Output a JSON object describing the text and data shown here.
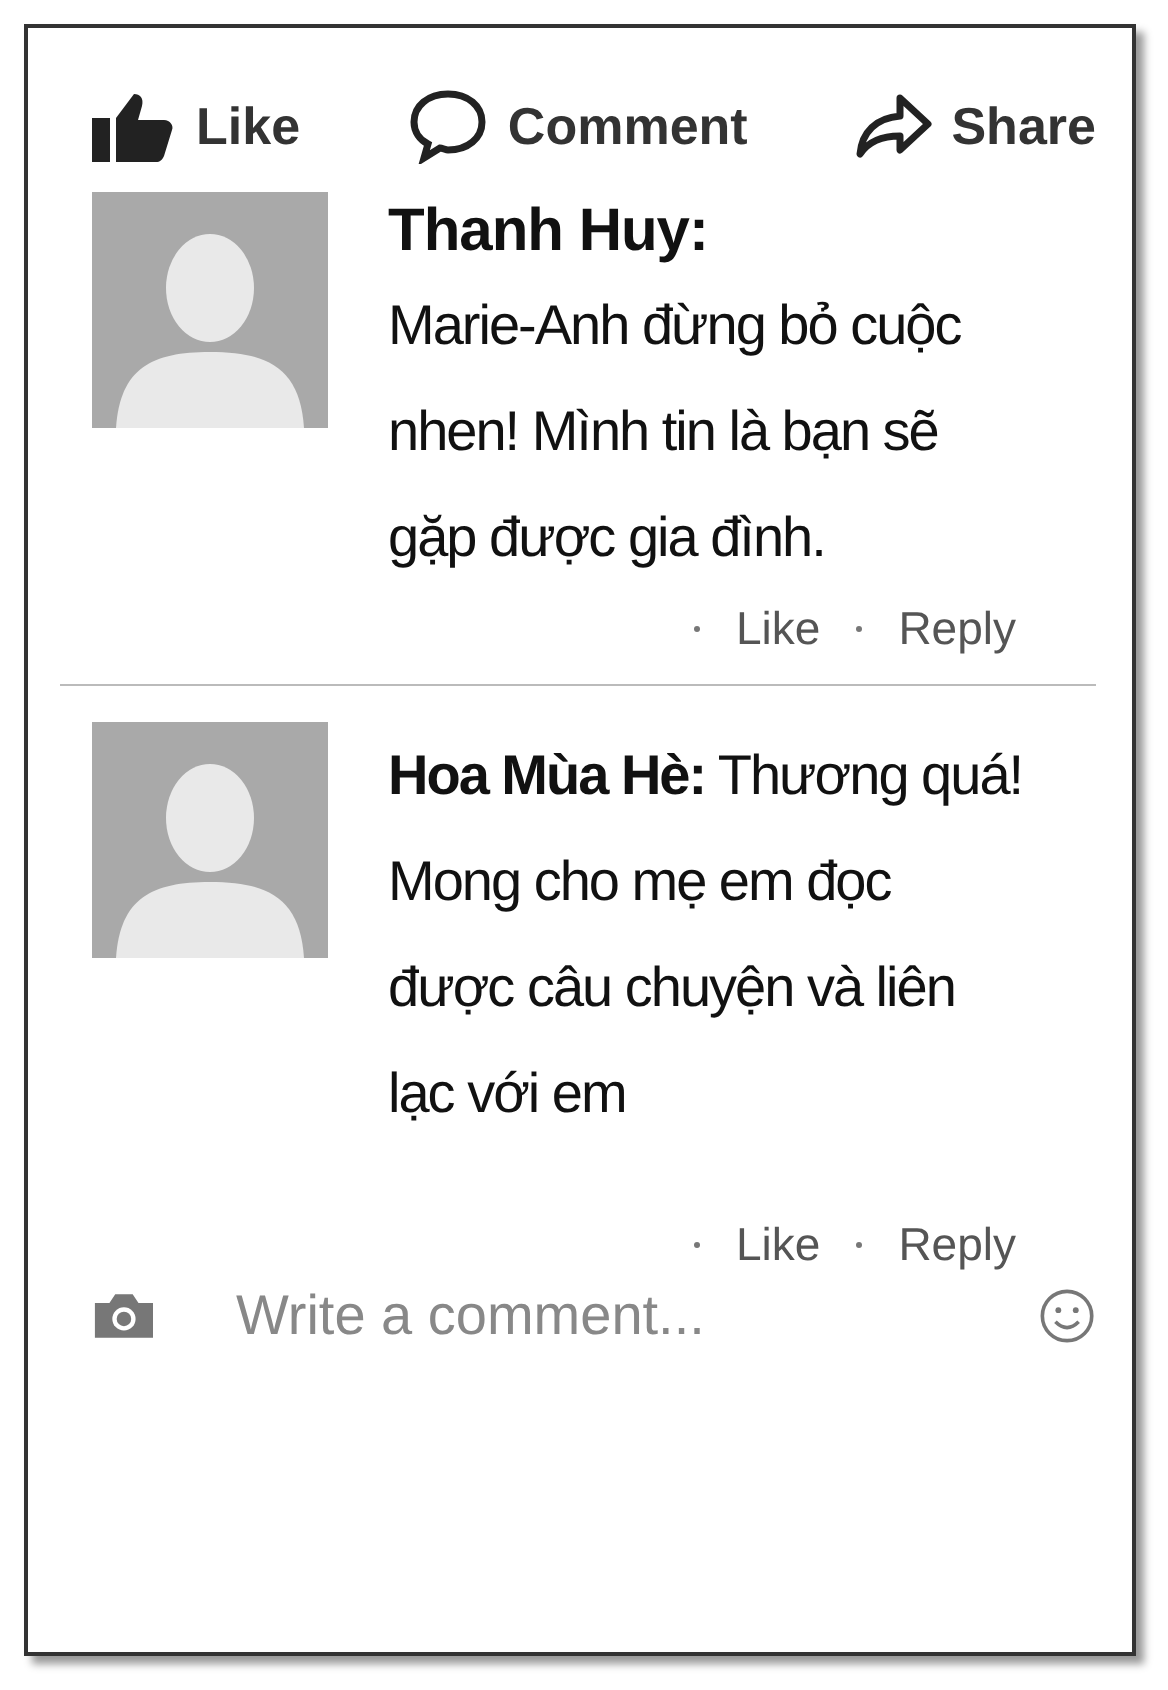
{
  "actions": [
    {
      "kind": "like",
      "label": "Like"
    },
    {
      "kind": "comment",
      "label": "Comment"
    },
    {
      "kind": "share",
      "label": "Share"
    }
  ],
  "comments": [
    {
      "kind": "name_above",
      "name": "Thanh Huy:",
      "text": "Marie-Anh đừng bỏ cuộc nhen! Mình tin là bạn sẽ gặp được gia đình.",
      "links": [
        "Like",
        "Reply"
      ]
    },
    {
      "kind": "name_inline",
      "text": "**Hoa Mùa Hè:** Thương quá! Mong cho mẹ em đọc được câu chuyện và liên lạc với em",
      "links": [
        "Like",
        "Reply"
      ]
    }
  ],
  "composer": {
    "placeholder": "Write a comment..."
  }
}
